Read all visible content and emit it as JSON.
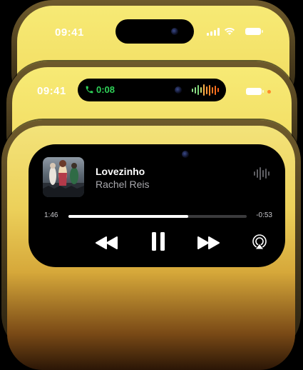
{
  "phone1": {
    "time": "09:41",
    "icons": [
      "cellular-signal-icon",
      "wifi-icon",
      "battery-icon"
    ]
  },
  "phone2": {
    "time": "09:41",
    "call_duration": "0:08",
    "icons": [
      "phone-call-icon",
      "audio-waveform-icon",
      "battery-icon",
      "recording-dot-indicator"
    ]
  },
  "phone3": {
    "now_playing": {
      "title": "Lovezinho",
      "artist": "Rachel Reis",
      "elapsed": "1:46",
      "remaining": "-0:53",
      "progress_fraction": 0.67,
      "icons": [
        "album-art",
        "sound-bars-icon",
        "rewind-icon",
        "pause-icon",
        "fast-forward-icon",
        "airplay-icon"
      ]
    }
  },
  "colors": {
    "screen_yellow": "#f3e37a",
    "call_green": "#2fd158",
    "recording_orange": "#ff8a2a"
  }
}
